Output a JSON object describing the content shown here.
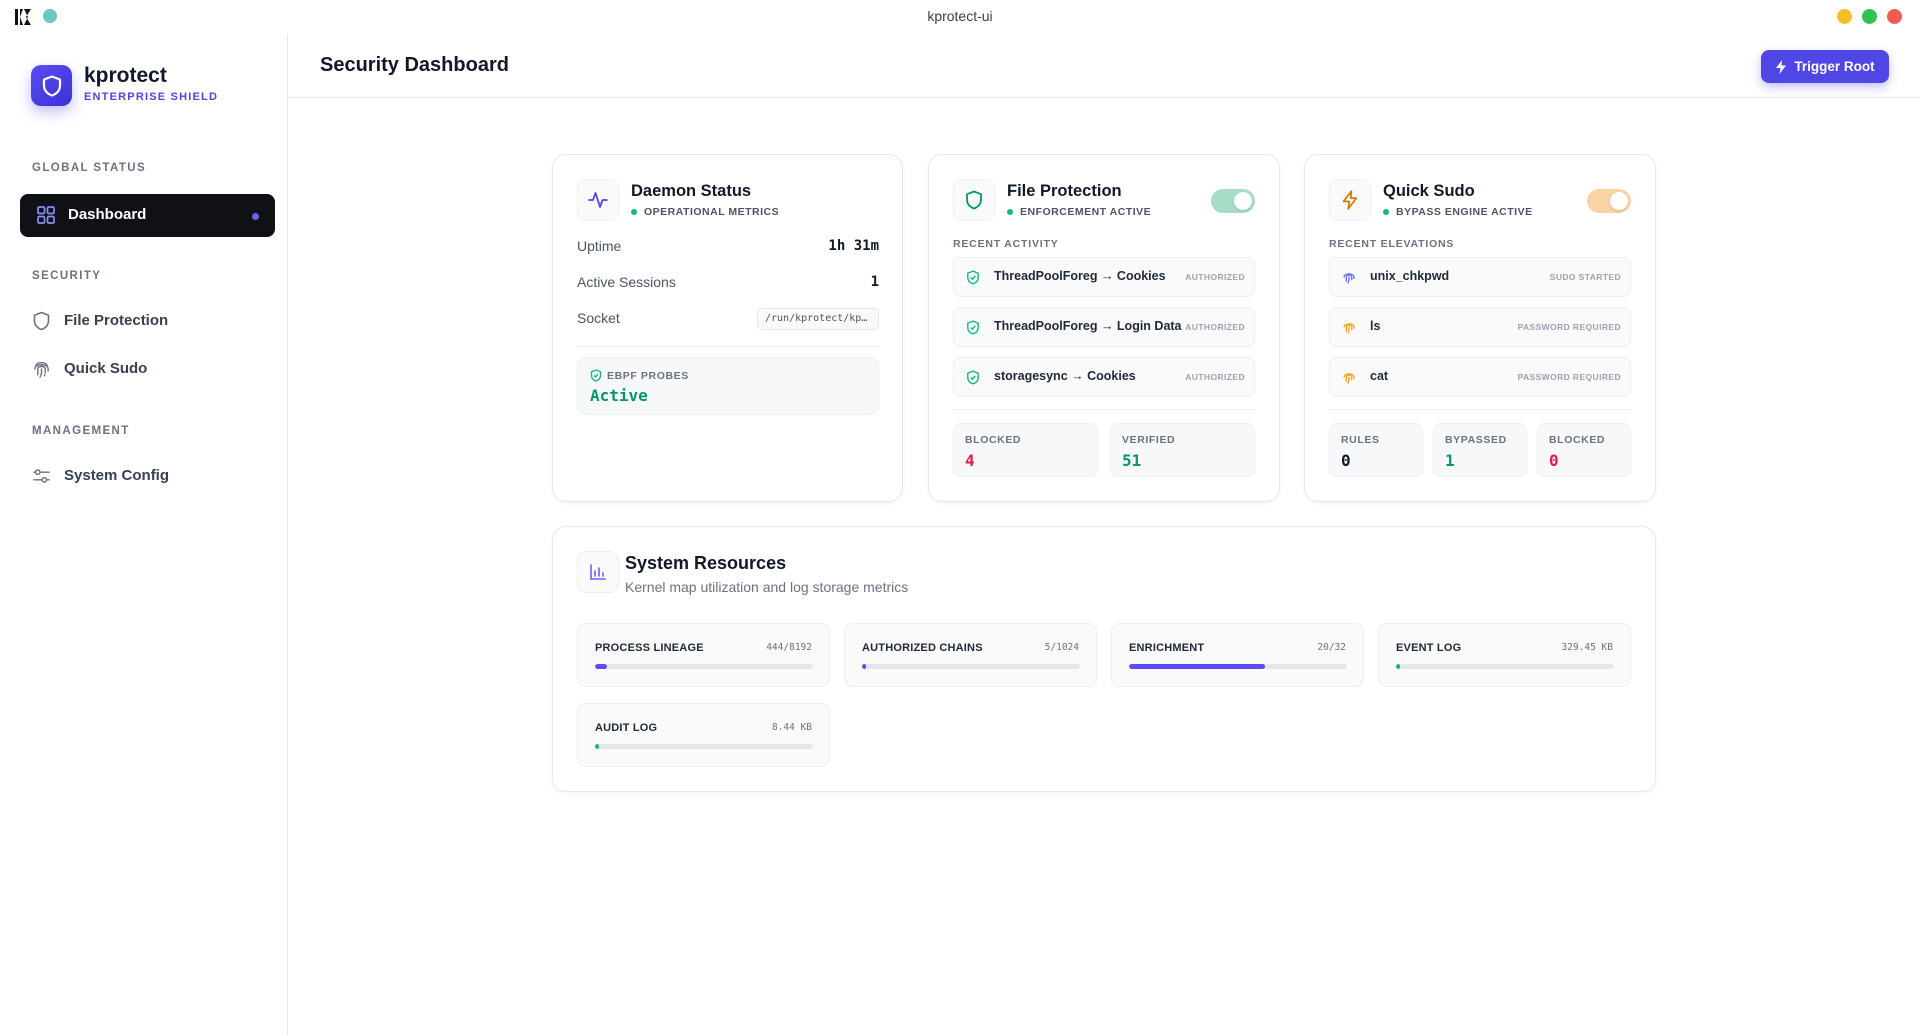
{
  "window": {
    "title": "kprotect-ui"
  },
  "brand": {
    "name": "kprotect",
    "subtitle": "ENTERPRISE SHIELD"
  },
  "sidebar": {
    "sections": [
      {
        "label": "GLOBAL STATUS"
      },
      {
        "label": "SECURITY"
      },
      {
        "label": "MANAGEMENT"
      }
    ],
    "items": [
      {
        "label": "Dashboard",
        "icon": "grid-icon",
        "active": true
      },
      {
        "label": "File Protection",
        "icon": "shield-icon"
      },
      {
        "label": "Quick Sudo",
        "icon": "fingerprint-icon"
      },
      {
        "label": "System Config",
        "icon": "sliders-icon"
      }
    ]
  },
  "header": {
    "title": "Security Dashboard",
    "trigger_label": "Trigger Root"
  },
  "daemon": {
    "title": "Daemon Status",
    "status": "OPERATIONAL METRICS",
    "metrics": [
      {
        "label": "Uptime",
        "value": "1h 31m"
      },
      {
        "label": "Active Sessions",
        "value": "1"
      },
      {
        "label": "Socket",
        "value": "/run/kprotect/kp…"
      }
    ],
    "probes": {
      "label": "EBPF PROBES",
      "value": "Active"
    }
  },
  "file_protection": {
    "title": "File Protection",
    "status": "ENFORCEMENT ACTIVE",
    "enabled": true,
    "list_label": "RECENT ACTIVITY",
    "activity": [
      {
        "text": "ThreadPoolForeg → Cookies",
        "badge": "AUTHORIZED"
      },
      {
        "text": "ThreadPoolForeg → Login Data",
        "badge": "AUTHORIZED"
      },
      {
        "text": "storagesync → Cookies",
        "badge": "AUTHORIZED"
      }
    ],
    "stats": [
      {
        "label": "BLOCKED",
        "value": "4",
        "color": "#e11d48"
      },
      {
        "label": "VERIFIED",
        "value": "51",
        "color": "#059669"
      }
    ]
  },
  "quick_sudo": {
    "title": "Quick Sudo",
    "status": "BYPASS ENGINE ACTIVE",
    "enabled": true,
    "list_label": "RECENT ELEVATIONS",
    "elevations": [
      {
        "text": "unix_chkpwd",
        "badge": "SUDO STARTED"
      },
      {
        "text": "ls",
        "badge": "PASSWORD REQUIRED"
      },
      {
        "text": "cat",
        "badge": "PASSWORD REQUIRED"
      }
    ],
    "stats": [
      {
        "label": "RULES",
        "value": "0",
        "color": "#111827"
      },
      {
        "label": "BYPASSED",
        "value": "1",
        "color": "#059669"
      },
      {
        "label": "BLOCKED",
        "value": "0",
        "color": "#e11d48"
      }
    ]
  },
  "resources": {
    "title": "System Resources",
    "subtitle": "Kernel map utilization and log storage metrics",
    "items": [
      {
        "label": "PROCESS LINEAGE",
        "value": "444/8192",
        "fraction": 0.054,
        "color": "#5b4df5"
      },
      {
        "label": "AUTHORIZED CHAINS",
        "value": "5/1024",
        "fraction": 0.02,
        "color": "#5b4df5"
      },
      {
        "label": "ENRICHMENT",
        "value": "20/32",
        "fraction": 0.625,
        "color": "#5b4df5"
      },
      {
        "label": "EVENT LOG",
        "value": "329.45 KB",
        "fraction": 0.02,
        "color": "#10b981"
      },
      {
        "label": "AUDIT LOG",
        "value": "8.44 KB",
        "fraction": 0.02,
        "color": "#10b981"
      }
    ]
  },
  "colors": {
    "accent": "#4f46e5",
    "success": "#10b981",
    "danger": "#e11d48",
    "sudo_accent": "#f59e0b"
  }
}
